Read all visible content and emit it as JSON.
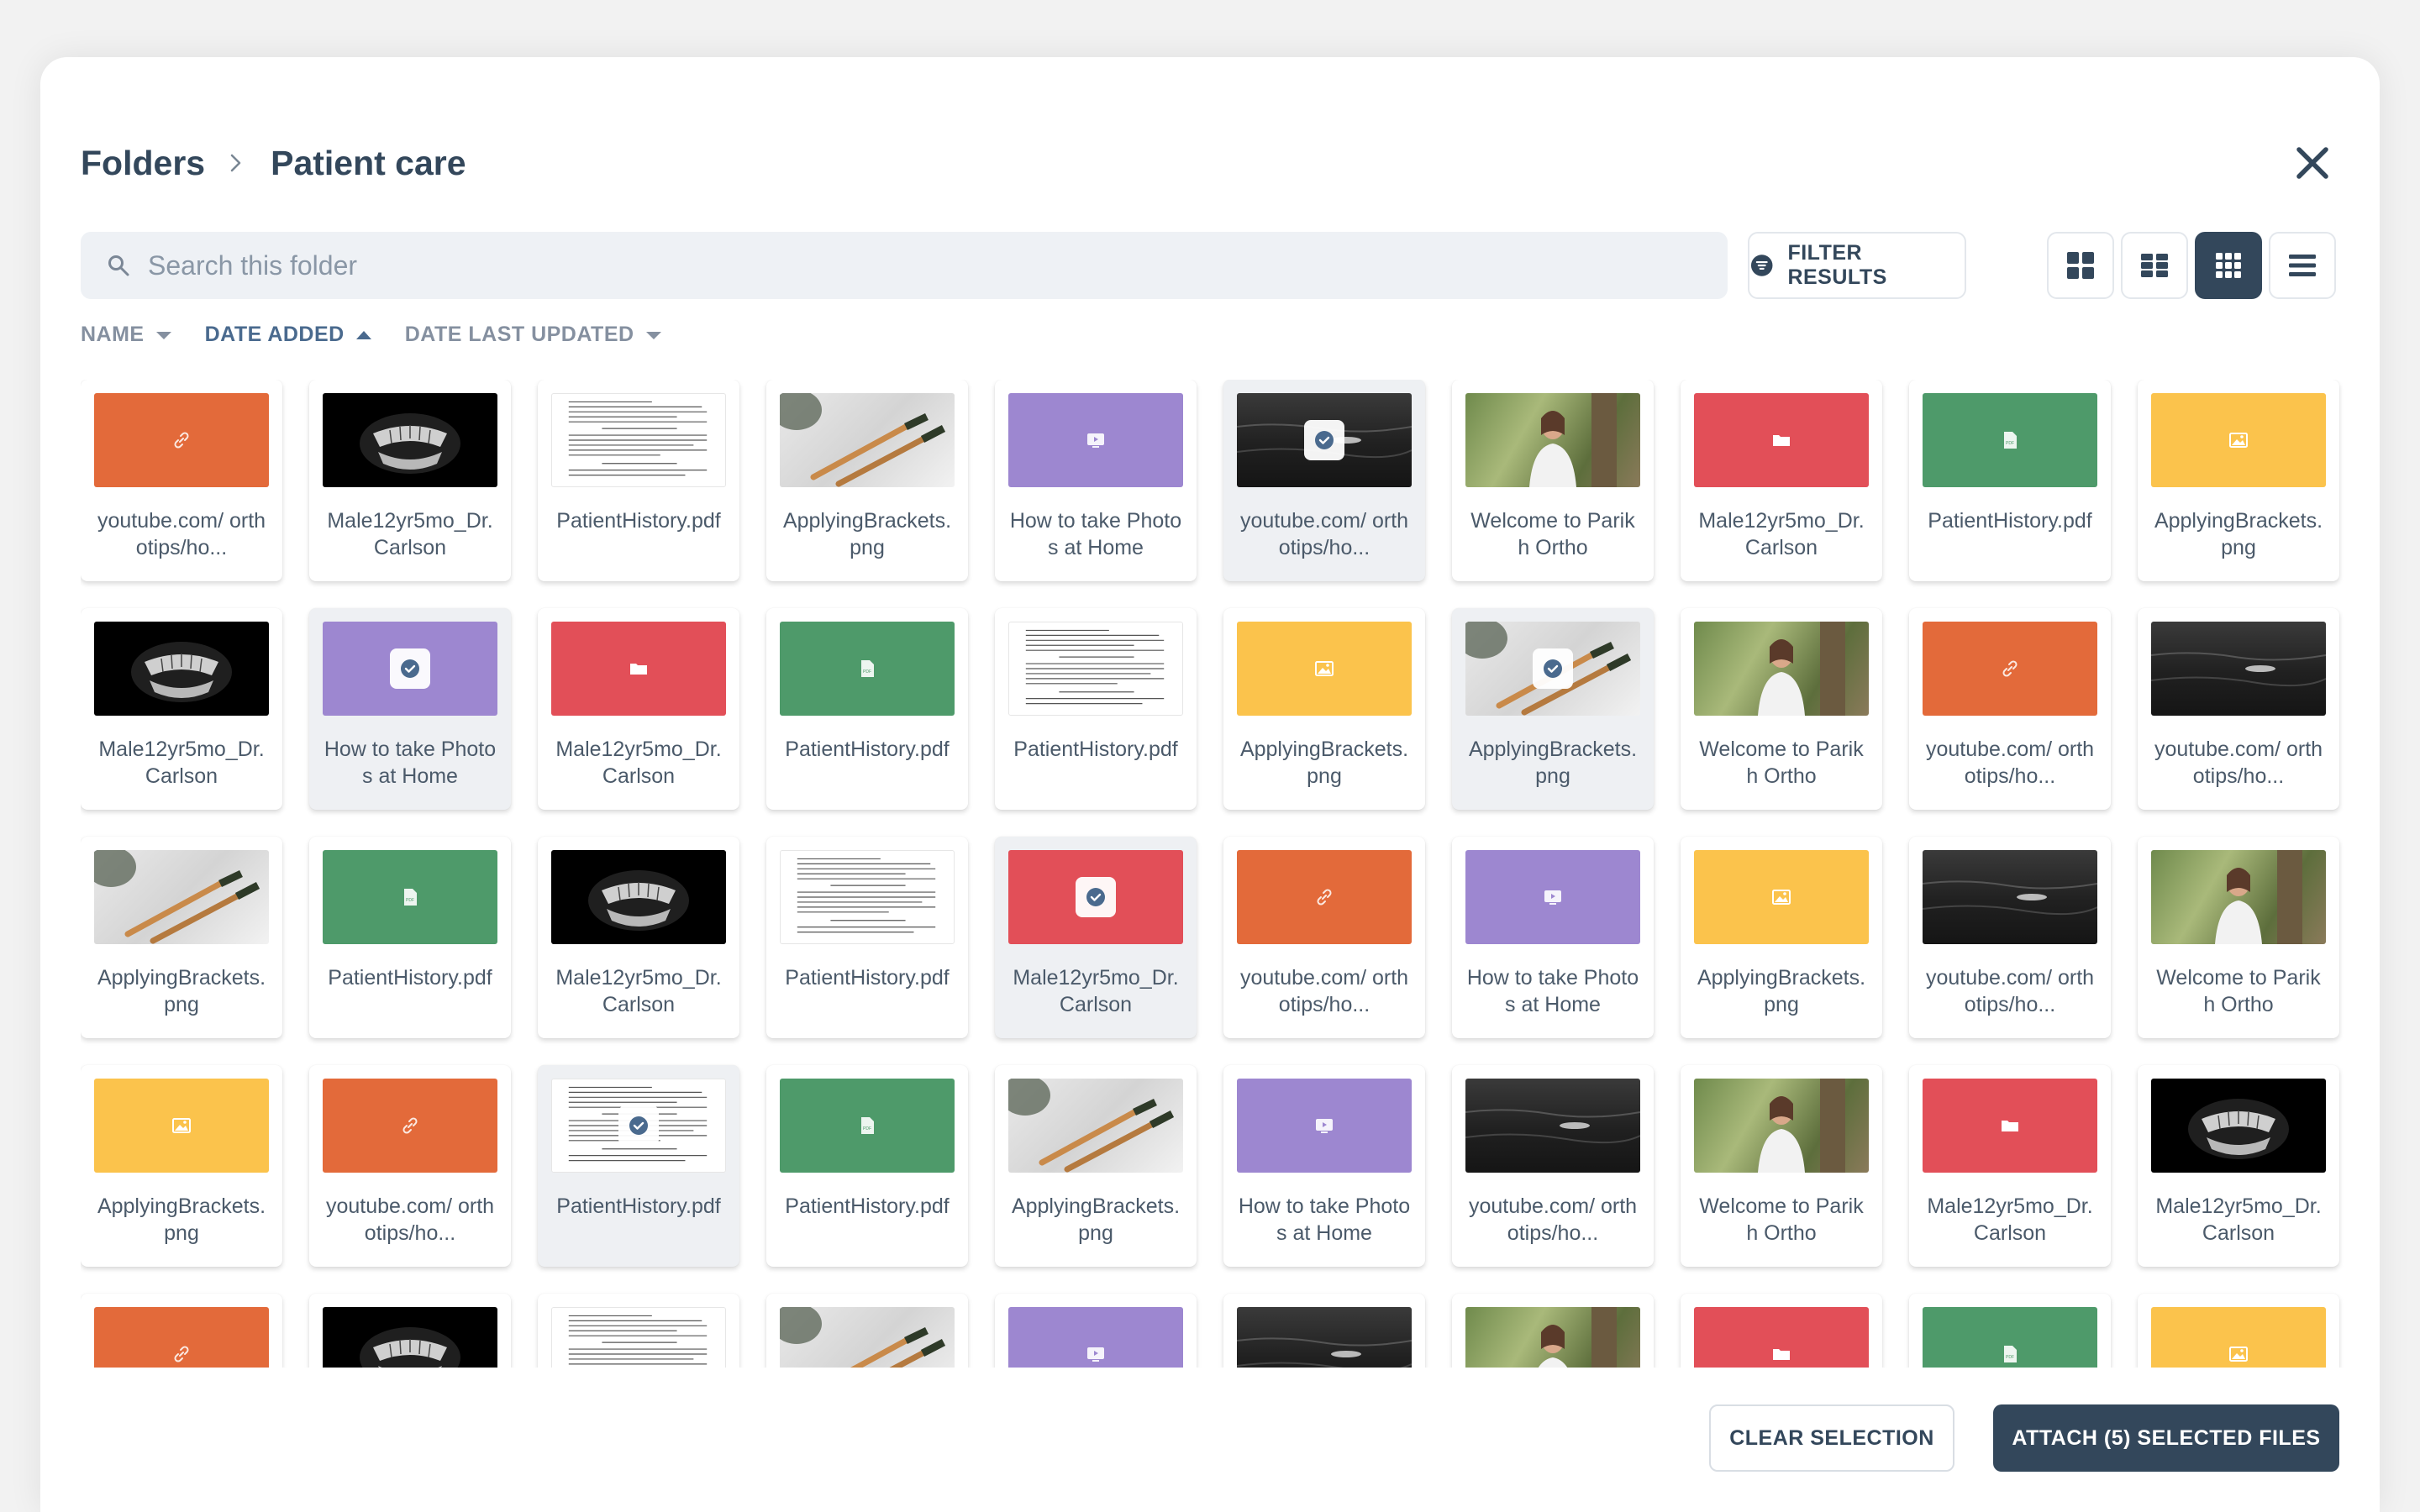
{
  "breadcrumb": {
    "root": "Folders",
    "current": "Patient care"
  },
  "search": {
    "placeholder": "Search this folder",
    "value": ""
  },
  "filter": {
    "label": "FILTER RESULTS"
  },
  "view_modes": {
    "active": "small-grid",
    "options": [
      "large-grid",
      "medium-grid",
      "small-grid",
      "list"
    ]
  },
  "sort": [
    {
      "label": "NAME",
      "direction": "down",
      "active": false
    },
    {
      "label": "DATE ADDED",
      "direction": "up",
      "active": true
    },
    {
      "label": "DATE LAST UPDATED",
      "direction": "down",
      "active": false
    }
  ],
  "files": [
    {
      "label": "youtube.com/ orthotips/ho...",
      "thumb": "orange",
      "icon": "link-icon",
      "selected": false
    },
    {
      "label": "Male12yr5mo_Dr. Carlson",
      "thumb": "black",
      "icon": "xray-image",
      "selected": false
    },
    {
      "label": "PatientHistory.pdf",
      "thumb": "doc",
      "icon": "document-preview",
      "selected": false
    },
    {
      "label": "ApplyingBrackets. png",
      "thumb": "brush",
      "icon": "photo",
      "selected": false
    },
    {
      "label": "How to take Photos at Home",
      "thumb": "purple",
      "icon": "video-icon",
      "selected": false
    },
    {
      "label": "youtube.com/ orthotips/ho...",
      "thumb": "ocean",
      "icon": "photo",
      "selected": true
    },
    {
      "label": "Welcome to Parikh Ortho",
      "thumb": "person",
      "icon": "photo",
      "selected": false
    },
    {
      "label": "Male12yr5mo_Dr. Carlson",
      "thumb": "red",
      "icon": "folder-icon",
      "selected": false
    },
    {
      "label": "PatientHistory.pdf",
      "thumb": "green",
      "icon": "pdf-icon",
      "selected": false
    },
    {
      "label": "ApplyingBrackets. png",
      "thumb": "yellow",
      "icon": "image-icon",
      "selected": false
    },
    {
      "label": "Male12yr5mo_Dr. Carlson",
      "thumb": "black",
      "icon": "xray-image",
      "selected": false
    },
    {
      "label": "How to take Photos at Home",
      "thumb": "purple",
      "icon": "video-icon",
      "selected": true
    },
    {
      "label": "Male12yr5mo_Dr. Carlson",
      "thumb": "red",
      "icon": "folder-icon",
      "selected": false
    },
    {
      "label": "PatientHistory.pdf",
      "thumb": "green",
      "icon": "pdf-icon",
      "selected": false
    },
    {
      "label": "PatientHistory.pdf",
      "thumb": "doc",
      "icon": "document-preview",
      "selected": false
    },
    {
      "label": "ApplyingBrackets. png",
      "thumb": "yellow",
      "icon": "image-icon",
      "selected": false
    },
    {
      "label": "ApplyingBrackets. png",
      "thumb": "brush",
      "icon": "photo",
      "selected": true
    },
    {
      "label": "Welcome to Parikh Ortho",
      "thumb": "person",
      "icon": "photo",
      "selected": false
    },
    {
      "label": "youtube.com/ orthotips/ho...",
      "thumb": "orange",
      "icon": "link-icon",
      "selected": false
    },
    {
      "label": "youtube.com/ orthotips/ho...",
      "thumb": "ocean",
      "icon": "photo",
      "selected": false
    },
    {
      "label": "ApplyingBrackets. png",
      "thumb": "brush",
      "icon": "photo",
      "selected": false
    },
    {
      "label": "PatientHistory.pdf",
      "thumb": "green",
      "icon": "pdf-icon",
      "selected": false
    },
    {
      "label": "Male12yr5mo_Dr. Carlson",
      "thumb": "black",
      "icon": "xray-image",
      "selected": false
    },
    {
      "label": "PatientHistory.pdf",
      "thumb": "doc",
      "icon": "document-preview",
      "selected": false
    },
    {
      "label": "Male12yr5mo_Dr. Carlson",
      "thumb": "red",
      "icon": "folder-icon",
      "selected": true
    },
    {
      "label": "youtube.com/ orthotips/ho...",
      "thumb": "orange",
      "icon": "link-icon",
      "selected": false
    },
    {
      "label": "How to take Photos at Home",
      "thumb": "purple",
      "icon": "video-icon",
      "selected": false
    },
    {
      "label": "ApplyingBrackets. png",
      "thumb": "yellow",
      "icon": "image-icon",
      "selected": false
    },
    {
      "label": "youtube.com/ orthotips/ho...",
      "thumb": "ocean",
      "icon": "photo",
      "selected": false
    },
    {
      "label": "Welcome to Parikh Ortho",
      "thumb": "person",
      "icon": "photo",
      "selected": false
    },
    {
      "label": "ApplyingBrackets. png",
      "thumb": "yellow",
      "icon": "image-icon",
      "selected": false
    },
    {
      "label": "youtube.com/ orthotips/ho...",
      "thumb": "orange",
      "icon": "link-icon",
      "selected": false
    },
    {
      "label": "PatientHistory.pdf",
      "thumb": "doc",
      "icon": "document-preview",
      "selected": true
    },
    {
      "label": "PatientHistory.pdf",
      "thumb": "green",
      "icon": "pdf-icon",
      "selected": false
    },
    {
      "label": "ApplyingBrackets. png",
      "thumb": "brush",
      "icon": "photo",
      "selected": false
    },
    {
      "label": "How to take Photos at Home",
      "thumb": "purple",
      "icon": "video-icon",
      "selected": false
    },
    {
      "label": "youtube.com/ orthotips/ho...",
      "thumb": "ocean",
      "icon": "photo",
      "selected": false
    },
    {
      "label": "Welcome to Parikh Ortho",
      "thumb": "person",
      "icon": "photo",
      "selected": false
    },
    {
      "label": "Male12yr5mo_Dr. Carlson",
      "thumb": "red",
      "icon": "folder-icon",
      "selected": false
    },
    {
      "label": "Male12yr5mo_Dr. Carlson",
      "thumb": "black",
      "icon": "xray-image",
      "selected": false
    },
    {
      "label": "",
      "thumb": "orange",
      "icon": "link-icon",
      "selected": false
    },
    {
      "label": "",
      "thumb": "black",
      "icon": "xray-image",
      "selected": false
    },
    {
      "label": "",
      "thumb": "doc",
      "icon": "document-preview",
      "selected": false
    },
    {
      "label": "",
      "thumb": "brush",
      "icon": "photo",
      "selected": false
    },
    {
      "label": "",
      "thumb": "purple",
      "icon": "video-icon",
      "selected": false
    },
    {
      "label": "",
      "thumb": "ocean",
      "icon": "photo",
      "selected": false
    },
    {
      "label": "",
      "thumb": "person",
      "icon": "photo",
      "selected": false
    },
    {
      "label": "",
      "thumb": "red",
      "icon": "folder-icon",
      "selected": false
    },
    {
      "label": "",
      "thumb": "green",
      "icon": "pdf-icon",
      "selected": false
    },
    {
      "label": "",
      "thumb": "yellow",
      "icon": "image-icon",
      "selected": false
    }
  ],
  "footer": {
    "clear_label": "CLEAR SELECTION",
    "attach_label": "ATTACH (5) SELECTED FILES"
  },
  "colors": {
    "primary": "#33475b",
    "orange": "#e36a3a",
    "purple": "#9d87d0",
    "red": "#e24f58",
    "green": "#4e9a6a",
    "yellow": "#fbc34c"
  }
}
